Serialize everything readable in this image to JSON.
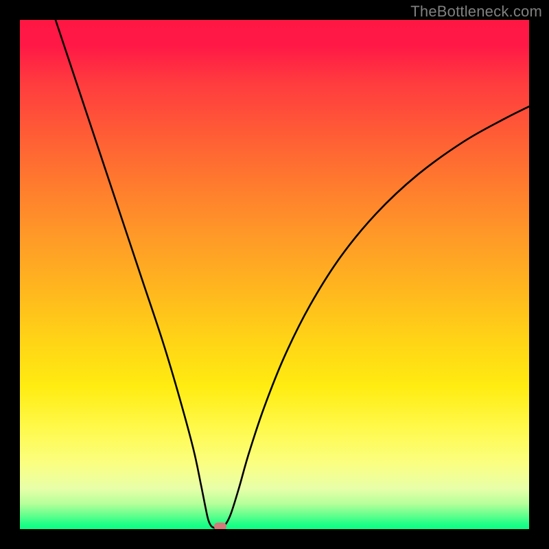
{
  "attribution": "TheBottleneck.com",
  "chart_data": {
    "type": "line",
    "title": "",
    "xlabel": "",
    "ylabel": "",
    "xlim": [
      0,
      100
    ],
    "ylim": [
      0,
      100
    ],
    "curve": {
      "name": "bottleneck-curve",
      "points": [
        {
          "x": 7.0,
          "y": 100.0
        },
        {
          "x": 9.0,
          "y": 94.0
        },
        {
          "x": 12.0,
          "y": 85.0
        },
        {
          "x": 16.0,
          "y": 73.0
        },
        {
          "x": 20.0,
          "y": 61.0
        },
        {
          "x": 24.0,
          "y": 49.0
        },
        {
          "x": 28.0,
          "y": 37.0
        },
        {
          "x": 31.0,
          "y": 27.0
        },
        {
          "x": 34.0,
          "y": 16.0
        },
        {
          "x": 35.5,
          "y": 9.0
        },
        {
          "x": 36.5,
          "y": 4.0
        },
        {
          "x": 37.0,
          "y": 1.8
        },
        {
          "x": 37.5,
          "y": 0.7
        },
        {
          "x": 38.0,
          "y": 0.3
        },
        {
          "x": 38.8,
          "y": 0.2
        },
        {
          "x": 39.6,
          "y": 0.35
        },
        {
          "x": 40.5,
          "y": 1.1
        },
        {
          "x": 41.5,
          "y": 3.2
        },
        {
          "x": 43.0,
          "y": 8.0
        },
        {
          "x": 45.0,
          "y": 15.0
        },
        {
          "x": 48.0,
          "y": 24.0
        },
        {
          "x": 52.0,
          "y": 34.0
        },
        {
          "x": 57.0,
          "y": 44.0
        },
        {
          "x": 63.0,
          "y": 53.5
        },
        {
          "x": 70.0,
          "y": 62.0
        },
        {
          "x": 78.0,
          "y": 69.5
        },
        {
          "x": 87.0,
          "y": 76.0
        },
        {
          "x": 95.0,
          "y": 80.5
        },
        {
          "x": 100.0,
          "y": 83.0
        }
      ]
    },
    "marker": {
      "x": 39.3,
      "y": 0.5,
      "color": "#d47a7a"
    },
    "background": {
      "type": "vertical-gradient",
      "stops": [
        {
          "pos": 0,
          "color": "#ff1744"
        },
        {
          "pos": 0.5,
          "color": "#ffb41f"
        },
        {
          "pos": 0.8,
          "color": "#fff94a"
        },
        {
          "pos": 1.0,
          "color": "#0aff84"
        }
      ]
    }
  }
}
